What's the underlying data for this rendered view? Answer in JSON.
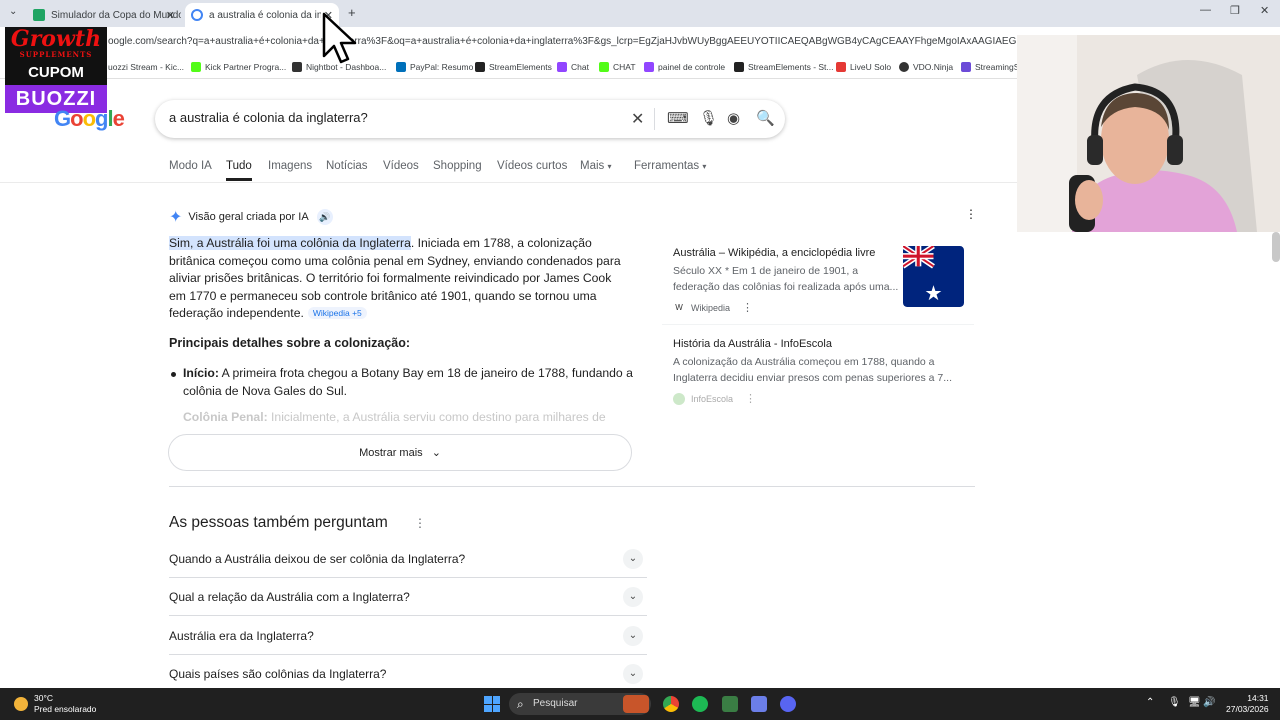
{
  "browser": {
    "tabs": [
      {
        "title": "Simulador da Copa do Mundo",
        "active": false,
        "favicon_color": "#1fa463"
      },
      {
        "title": "a australia é colonia da inglaterra",
        "active": true,
        "favicon_color": "#4285f4"
      }
    ],
    "new_tab": "+",
    "url": "oogle.com/search?q=a+australia+é+colonia+da+inglaterra%3F&oq=a+australia+é+colonia+da+inglaterra%3F&gs_lcrp=EgZjaHJvbWUyBggAEEUYOTIICAEQABgWGB4yCAgCEAAYFhgeMgoIAxAAGIAEGKIEMgoIBBAAGIAE",
    "bookmarks": [
      "uozzi Stream - Kic...",
      "Kick Partner Progra...",
      "Nightbot - Dashboa...",
      "PayPal: Resumo",
      "StreamElements",
      "Chat",
      "CHAT",
      "painel de controle",
      "StreamElements - St...",
      "LiveU Solo",
      "VDO.Ninja",
      "StreamingS"
    ]
  },
  "promo": {
    "line1": "Growth",
    "line1b": "SUPPLEMENTS",
    "line2": "CUPOM",
    "line3": "BUOZZI"
  },
  "google": {
    "logo": "Google",
    "query": "a australia é colonia da inglaterra?",
    "tabs": [
      "Modo IA",
      "Tudo",
      "Imagens",
      "Notícias",
      "Vídeos",
      "Shopping",
      "Vídeos curtos",
      "Mais",
      "Ferramentas"
    ]
  },
  "ai": {
    "title": "Visão geral criada por IA",
    "highlight": "Sim, a Austrália foi uma colônia da Inglaterra",
    "body": ". Iniciada em 1788, a colonização britânica começou como uma colônia penal em Sydney, enviando condenados para aliviar prisões britânicas. O território foi formalmente reivindicado por James Cook em 1770 e permaneceu sob controle britânico até 1901, quando se tornou uma federação independente.",
    "chip": "Wikipedia +5",
    "subtitle": "Principais detalhes sobre a colonização:",
    "item1_bold": "Início:",
    "item1_text": " A primeira frota chegou a Botany Bay em 18 de janeiro de 1788, fundando a colônia de Nova Gales do Sul.",
    "item2_bold": "Colônia Penal:",
    "item2_text": " Inicialmente, a Austrália serviu como destino para milhares de",
    "show_more": "Mostrar mais"
  },
  "sources": [
    {
      "title": "Austrália – Wikipédia, a enciclopédia livre",
      "line1": "Século XX * Em 1 de janeiro de 1901, a",
      "line2": "federação das colônias foi realizada após uma...",
      "site": "Wikipedia"
    },
    {
      "title": "História da Austrália - InfoEscola",
      "line1": "A colonização da Austrália começou em 1788, quando a",
      "line2": "Inglaterra decidiu enviar presos com penas superiores a 7...",
      "site": "InfoEscola"
    }
  ],
  "paa": {
    "title": "As pessoas também perguntam",
    "questions": [
      "Quando a Austrália deixou de ser colônia da Inglaterra?",
      "Qual a relação da Austrália com a Inglaterra?",
      "Austrália era da Inglaterra?",
      "Quais países são colônias da Inglaterra?"
    ]
  },
  "taskbar": {
    "temp": "30°C",
    "weather": "Pred ensolarado",
    "search": "Pesquisar",
    "time": "14:31",
    "date": "27/03/2026"
  }
}
